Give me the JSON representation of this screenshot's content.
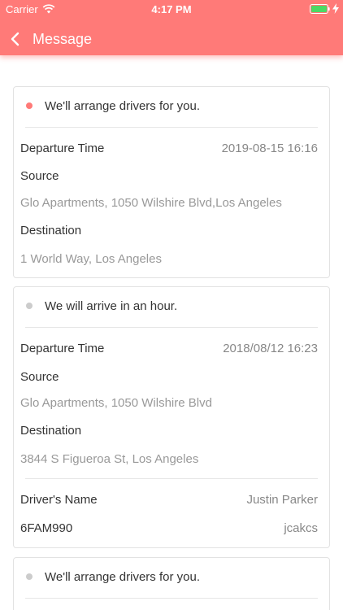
{
  "status_bar": {
    "carrier": "Carrier",
    "time": "4:17 PM",
    "battery_color": "#4cd964"
  },
  "nav": {
    "title": "Message"
  },
  "colors": {
    "accent": "#ff7a78",
    "dot_active": "#ff7a78",
    "dot_inactive": "#cccccc"
  },
  "messages": [
    {
      "title": "We'll arrange drivers for you.",
      "status": "active",
      "departure_label": "Departure Time",
      "departure_value": "2019-08-15 16:16",
      "source_label": "Source",
      "source_value": "Glo Apartments, 1050 Wilshire Blvd,Los Angeles",
      "destination_label": "Destination",
      "destination_value": "1 World Way, Los Angeles"
    },
    {
      "title": "We will arrive in an hour.",
      "status": "inactive",
      "departure_label": "Departure Time",
      "departure_value": "2018/08/12 16:23",
      "source_label": "Source",
      "source_value": "Glo Apartments, 1050 Wilshire Blvd",
      "destination_label": "Destination",
      "destination_value": "3844 S Figueroa St, Los Angeles",
      "driver_label": "Driver's Name",
      "driver_value": "Justin Parker",
      "plate": "6FAM990",
      "plate_value": "jcakcs"
    },
    {
      "title": "We'll arrange drivers for you.",
      "status": "inactive"
    }
  ]
}
